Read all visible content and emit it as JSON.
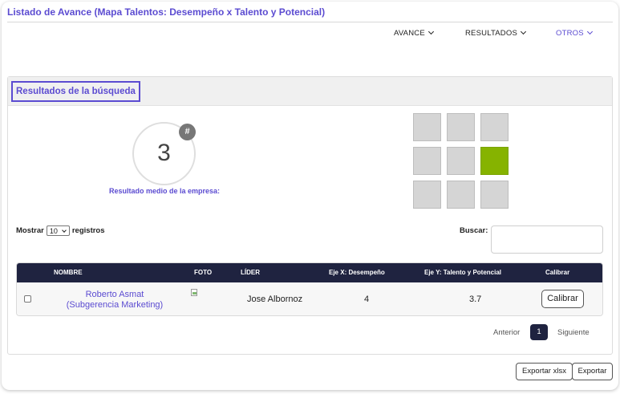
{
  "page": {
    "title": "Listado de Avance (Mapa Talentos: Desempeño x Talento y Potencial)"
  },
  "nav": {
    "avance": "AVANCE",
    "resultados": "RESULTADOS",
    "otros": "OTROS"
  },
  "panel": {
    "title": "Resultados de la búsqueda",
    "score": "3",
    "badge": "#",
    "score_caption": "Resultado medio de la empresa:",
    "grid": {
      "rows": 3,
      "cols": 3,
      "active_row": 2,
      "active_col": 3,
      "active_color": "#86b300",
      "inactive_color": "#d5d5d5"
    }
  },
  "controls": {
    "show_prefix": "Mostrar",
    "page_size": "10",
    "show_suffix": "registros",
    "search_label": "Buscar:",
    "search_value": ""
  },
  "table": {
    "headers": {
      "name": "NOMBRE",
      "photo": "FOTO",
      "leader": "LÍDER",
      "x": "Eje X: Desempeño",
      "y": "Eje Y: Talento y Potencial",
      "calibrate": "Calibrar"
    },
    "rows": [
      {
        "name_line1": "Roberto Asmat",
        "name_line2": "(Subgerencia Marketing)",
        "leader": "Jose Albornoz",
        "x": "4",
        "y": "3.7",
        "action": "Calibrar"
      }
    ]
  },
  "pagination": {
    "prev": "Anterior",
    "current": "1",
    "next": "Siguiente"
  },
  "actions": {
    "export_xlsx": "Exportar xlsx",
    "export": "Exportar"
  },
  "colors": {
    "accent": "#5b4bd1",
    "table_header": "#1f2340"
  }
}
